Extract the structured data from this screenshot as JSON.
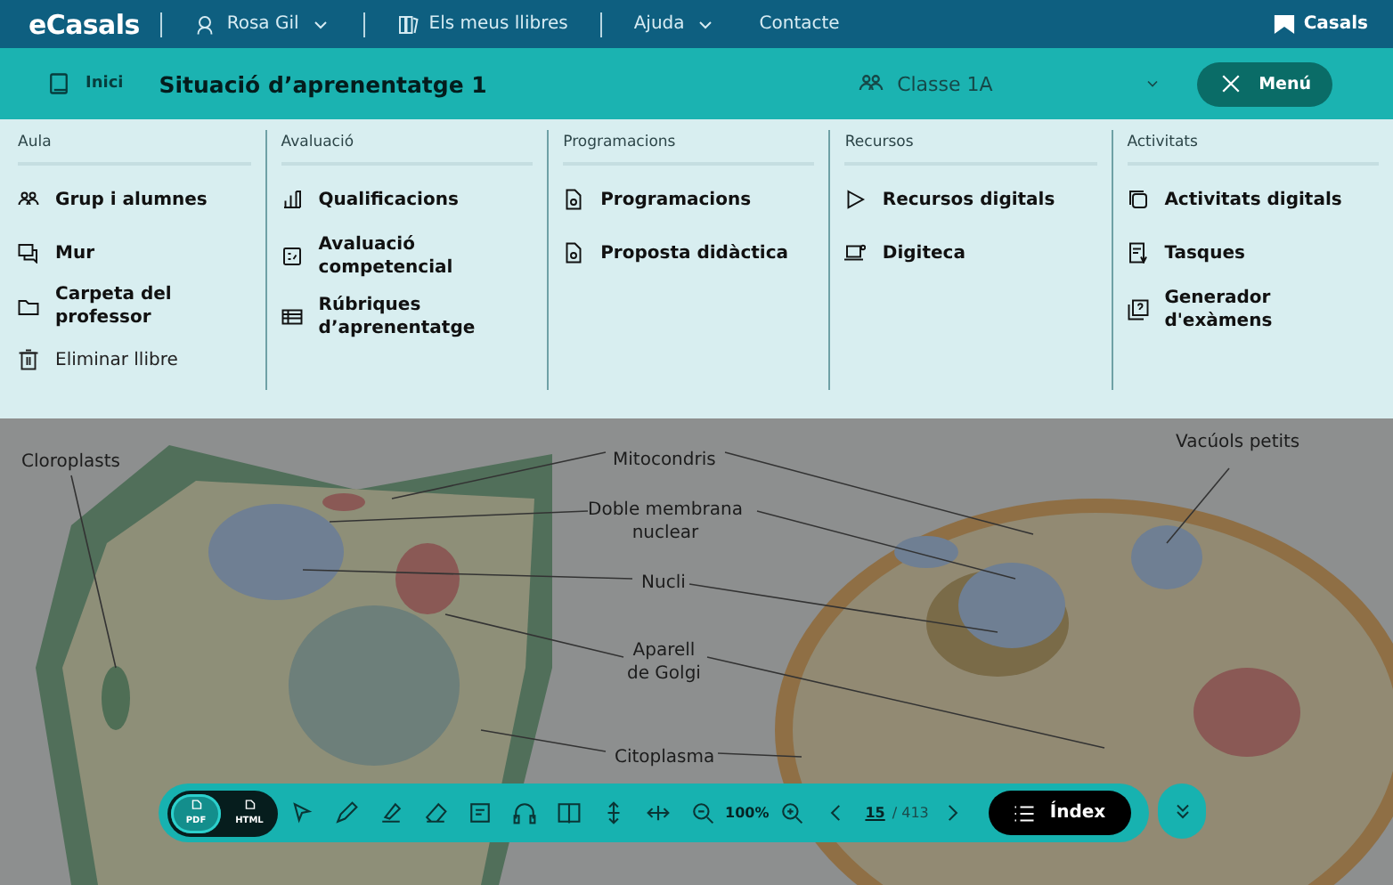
{
  "top_bar": {
    "logo": "eCasals",
    "user": "Rosa Gil",
    "links": [
      {
        "label": "Els meus llibres",
        "kind": "books"
      },
      {
        "label": "Ajuda",
        "kind": "dropdown"
      },
      {
        "label": "Contacte",
        "kind": "plain"
      }
    ],
    "brand": "Casals"
  },
  "header": {
    "home": "Inici",
    "title": "Situació d’aprenentatge 1",
    "class_select": {
      "value": "Classe 1A"
    },
    "menu_button": "Menú"
  },
  "menu": {
    "columns": [
      {
        "heading": "Aula",
        "items": [
          {
            "label": "Grup i alumnes",
            "kind": "link"
          },
          {
            "label": "Mur",
            "kind": "link"
          },
          {
            "label": "Carpeta del professor",
            "kind": "link"
          },
          {
            "label": "Eliminar llibre",
            "kind": "action"
          }
        ]
      },
      {
        "heading": "Avaluació",
        "items": [
          {
            "label": "Qualificacions",
            "kind": "link"
          },
          {
            "label": "Avaluació competencial",
            "kind": "link"
          },
          {
            "label": "Rúbriques d’aprenentatge",
            "kind": "link"
          }
        ]
      },
      {
        "heading": "Programacions",
        "items": [
          {
            "label": "Programacions",
            "kind": "link"
          },
          {
            "label": "Proposta didàctica",
            "kind": "link"
          }
        ]
      },
      {
        "heading": "Recursos",
        "items": [
          {
            "label": "Recursos digitals",
            "kind": "link"
          },
          {
            "label": "Digiteca",
            "kind": "link"
          }
        ]
      },
      {
        "heading": "Activitats",
        "items": [
          {
            "label": "Activitats digitals",
            "kind": "link"
          },
          {
            "label": "Tasques",
            "kind": "link"
          },
          {
            "label": "Generador d'exàmens",
            "kind": "link"
          }
        ]
      }
    ]
  },
  "illustration": {
    "labels": [
      "Cloroplasts",
      "Mitocondris",
      "Doble membrana\nnuclear",
      "Nucli",
      "Aparell\nde Golgi",
      "Citoplasma",
      "Vacúols petits"
    ]
  },
  "toolbar": {
    "formats": [
      {
        "label": "PDF",
        "selected": true
      },
      {
        "label": "HTML",
        "selected": false
      }
    ],
    "zoom": "100%",
    "page": "15",
    "total": "/ 413",
    "index_button": "Índex"
  }
}
